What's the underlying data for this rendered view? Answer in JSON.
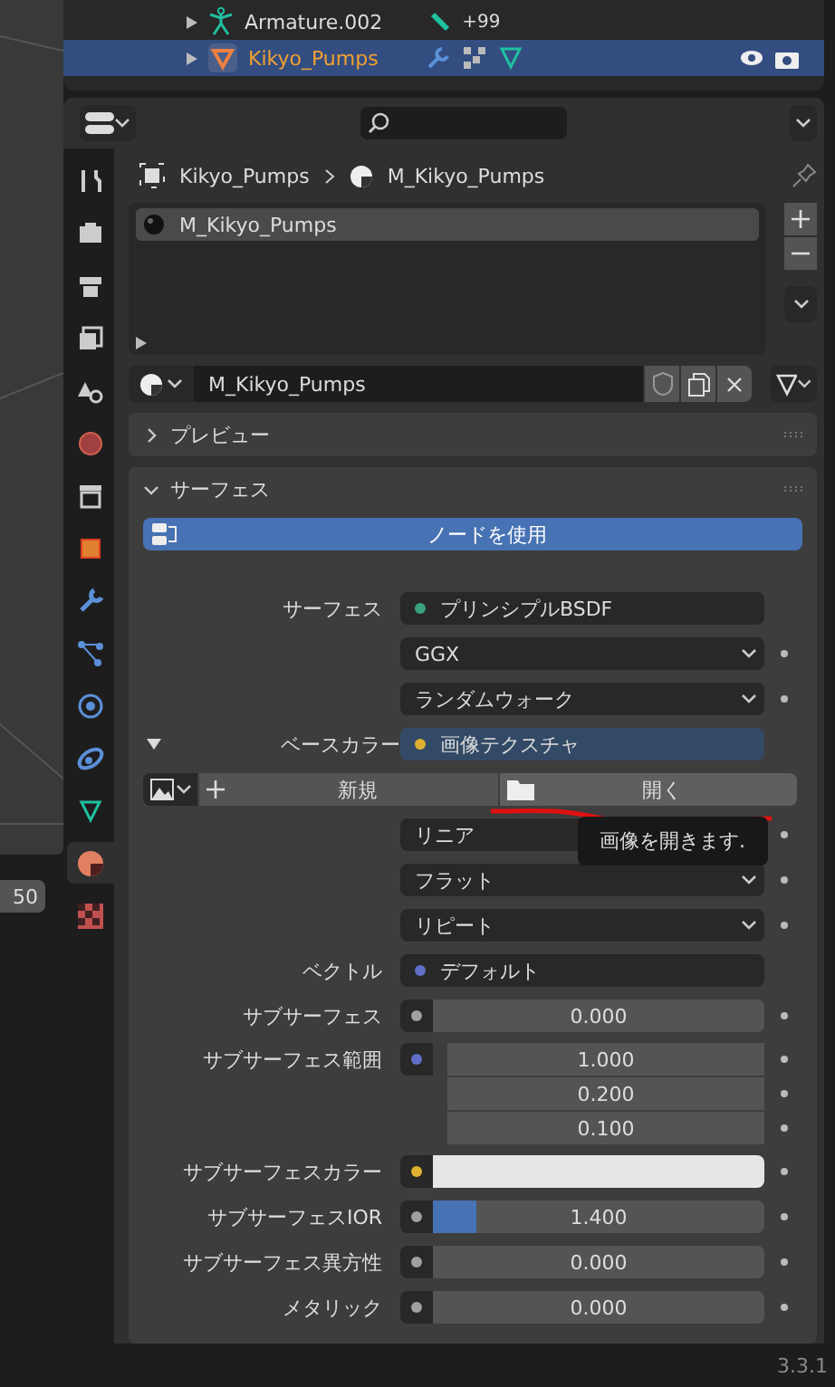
{
  "viewport": {
    "field_value": "50"
  },
  "outliner": {
    "rows": [
      {
        "name": "Armature.002",
        "kind": "armature",
        "badge": "+99",
        "selected": false
      },
      {
        "name": "Kikyo_Pumps",
        "kind": "mesh",
        "selected": true
      }
    ]
  },
  "breadcrumb": {
    "object": "Kikyo_Pumps",
    "material": "M_Kikyo_Pumps"
  },
  "sidebar_tabs": [
    {
      "kind": "tool",
      "selected": false
    },
    {
      "kind": "render",
      "selected": false
    },
    {
      "kind": "output",
      "selected": false
    },
    {
      "kind": "view",
      "selected": false
    },
    {
      "kind": "scene",
      "selected": false
    },
    {
      "kind": "world",
      "selected": false
    },
    {
      "kind": "collection",
      "selected": false
    },
    {
      "kind": "object",
      "selected": false
    },
    {
      "kind": "modifier",
      "selected": false
    },
    {
      "kind": "particles",
      "selected": false
    },
    {
      "kind": "physics",
      "selected": false
    },
    {
      "kind": "constraints",
      "selected": false
    },
    {
      "kind": "data",
      "selected": false
    },
    {
      "kind": "material",
      "selected": true
    },
    {
      "kind": "texture",
      "selected": false
    }
  ],
  "material_slots": [
    {
      "name": "M_Kikyo_Pumps",
      "selected": true
    }
  ],
  "material_field": {
    "value": "M_Kikyo_Pumps"
  },
  "panels": [
    {
      "title": "プレビュー",
      "expanded": false
    },
    {
      "title": "サーフェス",
      "expanded": true
    }
  ],
  "use_nodes_button": "ノードを使用",
  "rows": [
    {
      "kind": "socket",
      "label": "サーフェス",
      "value": "プリンシプルBSDF",
      "color": "#3aa080",
      "keyframe": false,
      "highlighted": false
    },
    {
      "kind": "enum",
      "value": "GGX",
      "keyframe": true
    },
    {
      "kind": "enum",
      "value": "ランダムウォーク",
      "keyframe": true
    },
    {
      "kind": "socket",
      "label": "ベースカラー",
      "value": "画像テクスチャ",
      "color": "#e0b030",
      "keyframe": false,
      "highlighted": true,
      "expanded": true
    },
    {
      "kind": "image",
      "new_label": "新規",
      "open_label": "開く"
    },
    {
      "kind": "enum",
      "value": "リニア",
      "keyframe": true
    },
    {
      "kind": "enum",
      "value": "フラット",
      "keyframe": true
    },
    {
      "kind": "enum",
      "value": "リピート",
      "keyframe": true
    },
    {
      "kind": "socket",
      "label": "ベクトル",
      "value": "デフォルト",
      "color": "#6070c8",
      "keyframe": false,
      "highlighted": false
    },
    {
      "kind": "number",
      "label": "サブサーフェス",
      "value": "0.000",
      "color": "#a0a0a0"
    },
    {
      "kind": "vector",
      "label": "サブサーフェス範囲",
      "values": [
        "1.000",
        "0.200",
        "0.100"
      ],
      "color": "#6070c8"
    },
    {
      "kind": "color",
      "label": "サブサーフェスカラー",
      "color": "#e0b030"
    },
    {
      "kind": "slider",
      "label": "サブサーフェスIOR",
      "value": "1.400",
      "level": 0.13,
      "color": "#a0a0a0"
    },
    {
      "kind": "number",
      "label": "サブサーフェス異方性",
      "value": "0.000",
      "color": "#a0a0a0"
    },
    {
      "kind": "number",
      "label": "メタリック",
      "value": "0.000",
      "color": "#a0a0a0"
    }
  ],
  "tooltip": "画像を開きます.",
  "version": "3.3.1"
}
